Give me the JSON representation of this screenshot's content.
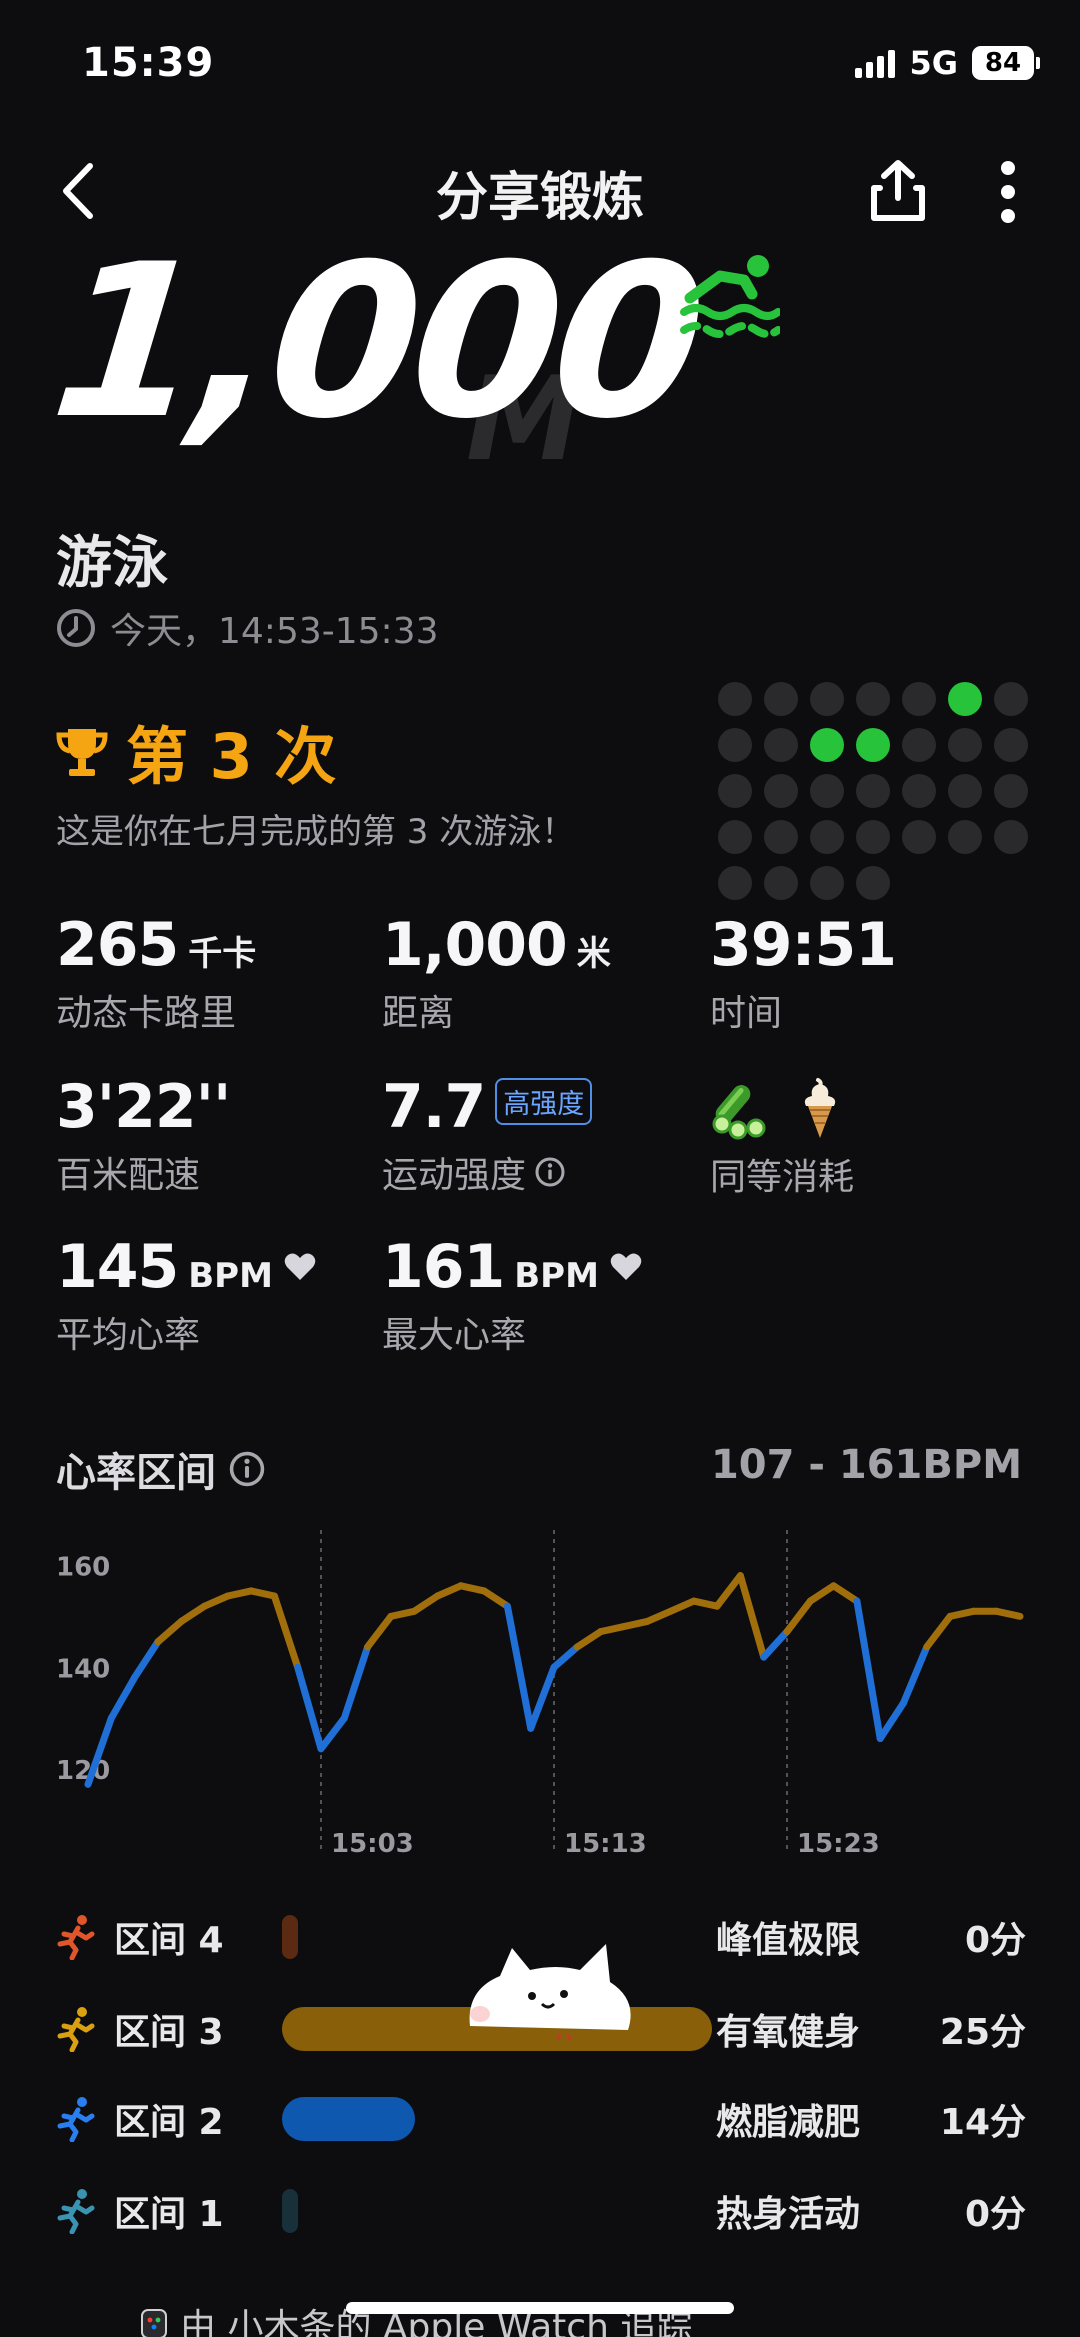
{
  "status": {
    "time": "15:39",
    "network": "5G",
    "battery": "84"
  },
  "nav": {
    "title": "分享锻炼"
  },
  "hero": {
    "distance": "1,000",
    "unit": "M",
    "sport": "游泳",
    "time_range": "今天，14:53-15:33"
  },
  "achievement": {
    "label": "第 3 次",
    "description": "这是你在七月完成的第 3 次游泳！",
    "calendar_dots": [
      0,
      0,
      0,
      0,
      0,
      1,
      0,
      0,
      0,
      1,
      1,
      0,
      0,
      0,
      0,
      0,
      0,
      0,
      0,
      0,
      0,
      0,
      0,
      0,
      0,
      0,
      0,
      0,
      0,
      0,
      0,
      0,
      -1,
      -1,
      -1
    ]
  },
  "metrics": {
    "calories": {
      "value": "265",
      "unit": "千卡",
      "label": "动态卡路里"
    },
    "distance": {
      "value": "1,000",
      "unit": "米",
      "label": "距离"
    },
    "duration": {
      "value": "39:51",
      "label": "时间"
    },
    "pace": {
      "value": "3'22''",
      "label": "百米配速"
    },
    "intensity": {
      "value": "7.7",
      "badge": "高强度",
      "label": "运动强度"
    },
    "equivalent": {
      "label": "同等消耗",
      "icons": [
        "cucumber-icon",
        "ice-cream-icon"
      ]
    },
    "avg_hr": {
      "value": "145",
      "unit": "BPM",
      "label": "平均心率"
    },
    "max_hr": {
      "value": "161",
      "unit": "BPM",
      "label": "最大心率"
    }
  },
  "heart_rate": {
    "title": "心率区间",
    "range": "107 - 161BPM"
  },
  "chart_data": {
    "type": "line",
    "ylim": [
      110,
      165
    ],
    "y_ticks": [
      "160",
      "140",
      "120"
    ],
    "x_ticks": [
      "15:03",
      "15:13",
      "15:23"
    ],
    "zone_threshold": 145,
    "colors": {
      "high": "#a06f0c",
      "low": "#1f6fd6"
    },
    "x_minutes": [
      0,
      1,
      2,
      3,
      4,
      5,
      6,
      7,
      8,
      9,
      10,
      11,
      12,
      13,
      14,
      15,
      16,
      17,
      18,
      19,
      20,
      21,
      22,
      23,
      24,
      25,
      26,
      27,
      28,
      29,
      30,
      31,
      32,
      33,
      34,
      35,
      36,
      37,
      38,
      39,
      40
    ],
    "values": [
      117,
      130,
      138,
      145,
      149,
      152,
      154,
      155,
      154,
      140,
      124,
      130,
      144,
      150,
      151,
      154,
      156,
      155,
      152,
      128,
      140,
      144,
      147,
      148,
      149,
      151,
      153,
      152,
      158,
      142,
      147,
      153,
      156,
      153,
      126,
      133,
      144,
      150,
      151,
      151,
      150
    ]
  },
  "zones": [
    {
      "name": "区间 4",
      "type": "峰值极限",
      "time": "0分",
      "fraction": 0.03,
      "color": "#5a2a12",
      "icon_color": "#e0562a"
    },
    {
      "name": "区间 3",
      "type": "有氧健身",
      "time": "25分",
      "fraction": 1.0,
      "color": "#8a5f0a",
      "icon_color": "#d9a011"
    },
    {
      "name": "区间 2",
      "type": "燃脂减肥",
      "time": "14分",
      "fraction": 0.31,
      "color": "#0e58b0",
      "icon_color": "#2a7ff0"
    },
    {
      "name": "区间 1",
      "type": "热身活动",
      "time": "0分",
      "fraction": 0.03,
      "color": "#17303a",
      "icon_color": "#3a93b0"
    }
  ],
  "footer": {
    "text": "由 小木条的 Apple Watch 追踪"
  }
}
